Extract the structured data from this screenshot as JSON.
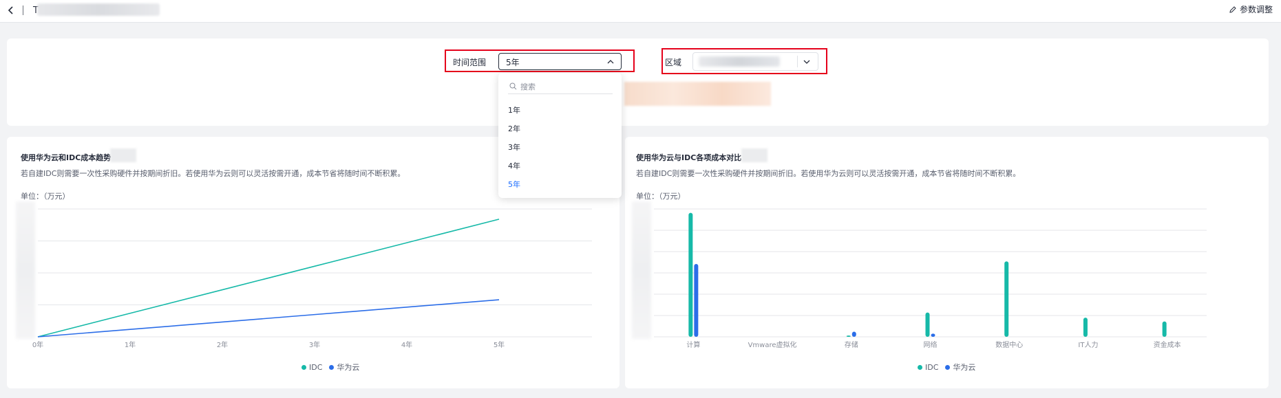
{
  "header": {
    "title": "T",
    "param_btn_label": "参数调整"
  },
  "filters": {
    "time_range_label": "时间范围",
    "time_range_value": "5年",
    "region_label": "区域",
    "dropdown": {
      "search_placeholder": "搜索",
      "options": [
        "1年",
        "2年",
        "3年",
        "4年",
        "5年"
      ],
      "selected": "5年"
    }
  },
  "colors": {
    "idc": "#16b9a8",
    "huawei": "#2b6de8",
    "accent": "#1a6cff",
    "highlight_border": "#e5001a"
  },
  "left_card": {
    "title": "使用华为云和IDC成本趋势",
    "desc": "若自建IDC则需要一次性采购硬件并按期间折旧。若使用华为云则可以灵活按需开通，成本节省将随时间不断积累。",
    "unit": "单位：（万元）",
    "legend": {
      "idc": "IDC",
      "huawei": "华为云"
    }
  },
  "right_card": {
    "title": "使用华为云与IDC各项成本对比",
    "desc": "若自建IDC则需要一次性采购硬件并按期间折旧。若使用华为云则可以灵活按需开通，成本节省将随时间不断积累。",
    "unit": "单位：（万元）",
    "legend": {
      "idc": "IDC",
      "huawei": "华为云"
    }
  },
  "chart_data": [
    {
      "type": "line",
      "x": [
        "0年",
        "1年",
        "2年",
        "3年",
        "4年",
        "5年"
      ],
      "ylim": [
        0,
        100
      ],
      "series": [
        {
          "name": "IDC",
          "values": [
            0,
            18.4,
            36.8,
            55.2,
            73.6,
            92
          ]
        },
        {
          "name": "华为云",
          "values": [
            0,
            5.8,
            11.6,
            17.4,
            23.2,
            29
          ]
        }
      ],
      "legend_position": "bottom",
      "grid": true
    },
    {
      "type": "bar",
      "categories": [
        "计算",
        "Vmware虚拟化",
        "存储",
        "网络",
        "数据中心",
        "IT人力",
        "资金成本"
      ],
      "ylim": [
        0,
        100
      ],
      "series": [
        {
          "name": "IDC",
          "values": [
            97,
            0,
            1,
            19,
            59,
            15,
            12
          ]
        },
        {
          "name": "华为云",
          "values": [
            57,
            0,
            4,
            2.5,
            0,
            0,
            0
          ]
        }
      ],
      "legend_position": "bottom",
      "grid": true
    }
  ]
}
